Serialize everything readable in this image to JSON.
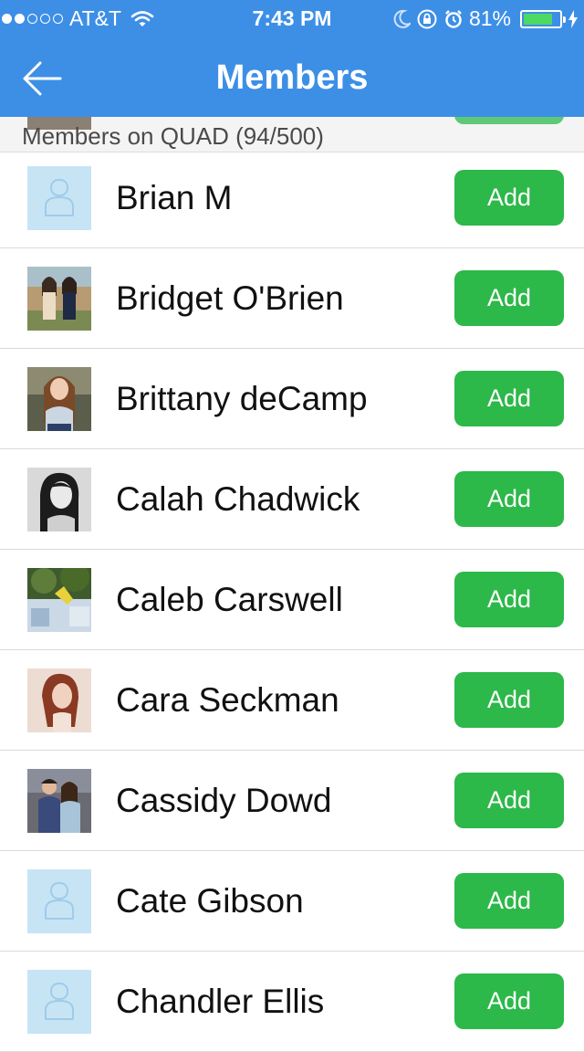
{
  "status_bar": {
    "carrier": "AT&T",
    "time": "7:43 PM",
    "battery": "81%",
    "battery_level": 0.81,
    "signal_bars_filled": 2,
    "signal_bars_total": 5,
    "icons": [
      "wifi-icon",
      "moon-icon",
      "rotation-lock-icon",
      "alarm-icon",
      "battery-icon",
      "charging-bolt-icon"
    ]
  },
  "nav": {
    "title": "Members",
    "back_icon": "back-arrow-icon"
  },
  "section": {
    "title": "Members on QUAD (94/500)"
  },
  "members": [
    {
      "name": "Brian M",
      "add_label": "Add",
      "avatar": "placeholder-avatar"
    },
    {
      "name": "Bridget O'Brien",
      "add_label": "Add",
      "avatar": "photo-avatar"
    },
    {
      "name": "Brittany deCamp",
      "add_label": "Add",
      "avatar": "photo-avatar"
    },
    {
      "name": "Calah Chadwick",
      "add_label": "Add",
      "avatar": "photo-avatar"
    },
    {
      "name": "Caleb Carswell",
      "add_label": "Add",
      "avatar": "photo-avatar"
    },
    {
      "name": "Cara Seckman",
      "add_label": "Add",
      "avatar": "photo-avatar"
    },
    {
      "name": "Cassidy Dowd",
      "add_label": "Add",
      "avatar": "photo-avatar"
    },
    {
      "name": "Cate Gibson",
      "add_label": "Add",
      "avatar": "placeholder-avatar"
    },
    {
      "name": "Chandler Ellis",
      "add_label": "Add",
      "avatar": "placeholder-avatar"
    }
  ],
  "colors": {
    "nav_bar": "#3d8fe6",
    "add_button": "#2db84a",
    "placeholder_avatar": "#c7e4f5",
    "battery_fill": "#4cd964"
  }
}
